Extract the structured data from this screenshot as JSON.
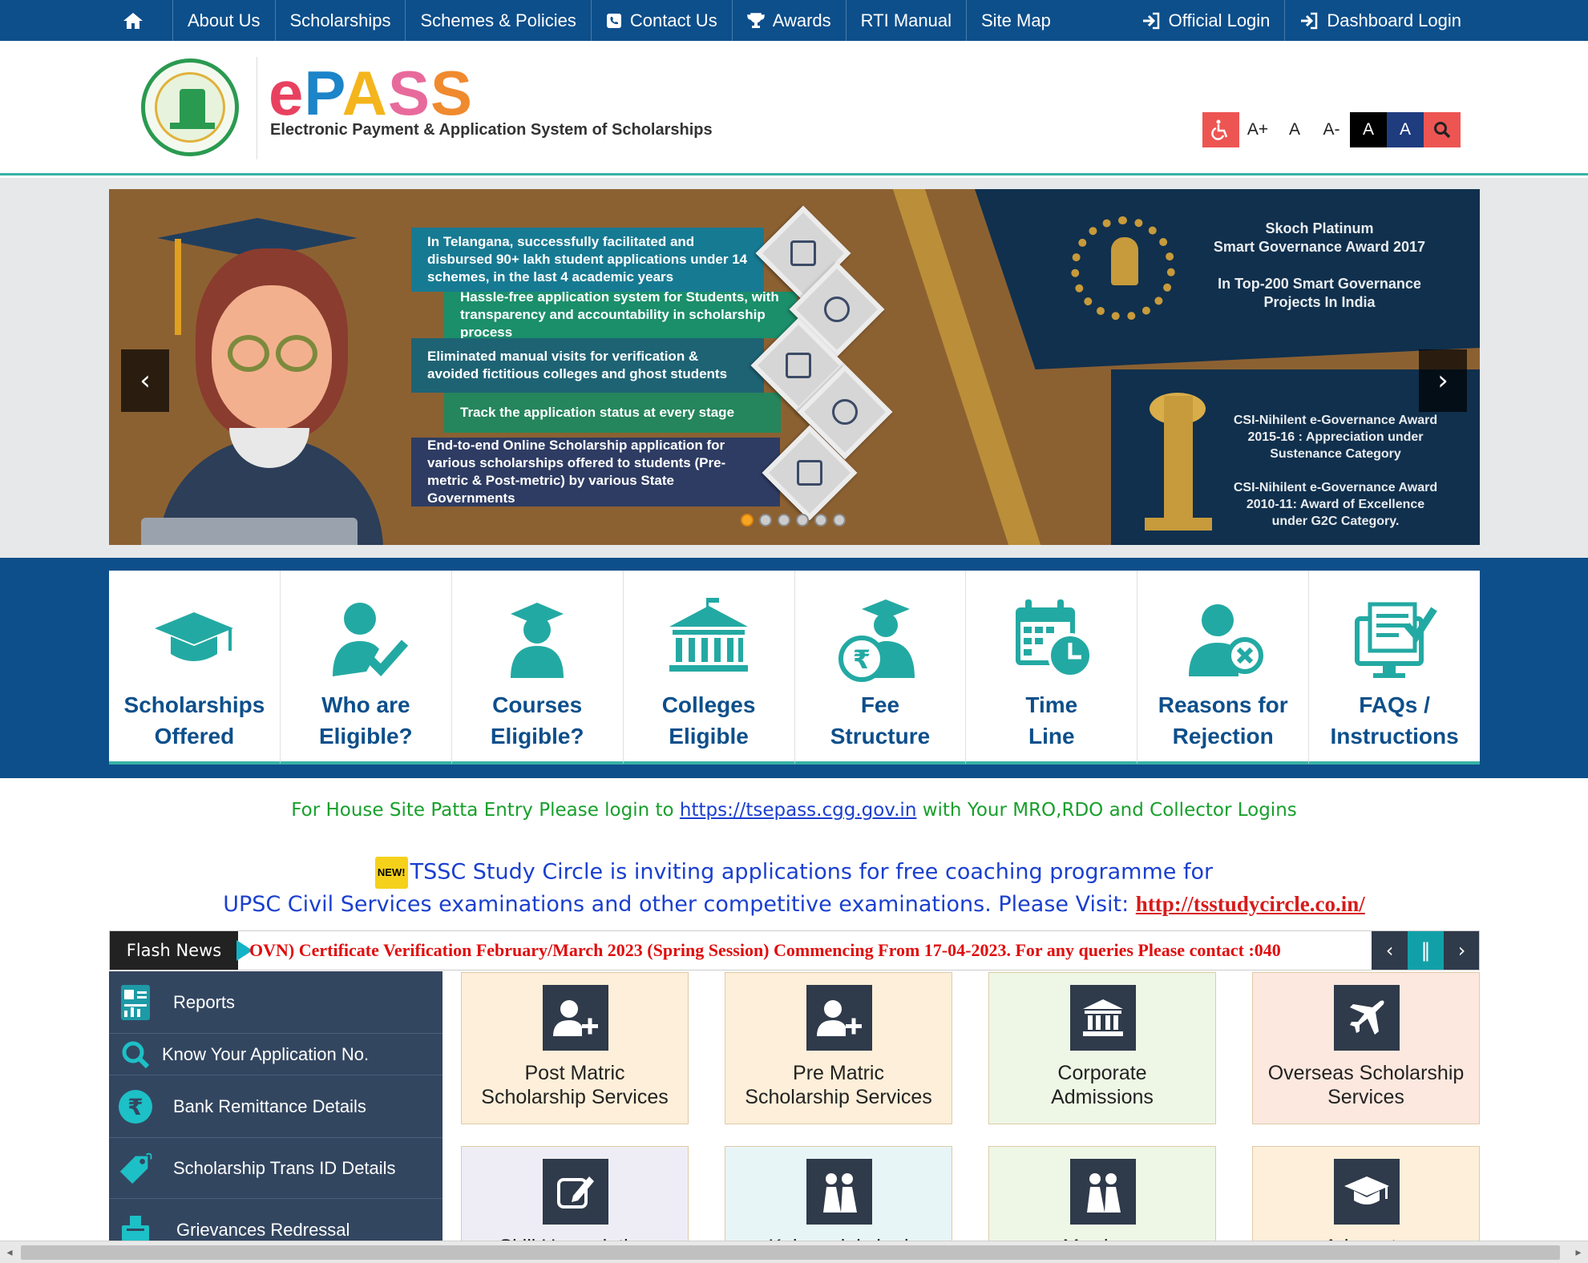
{
  "topnav": {
    "left": [
      {
        "label": "About Us"
      },
      {
        "label": "Scholarships"
      },
      {
        "label": "Schemes & Policies"
      },
      {
        "label": "Contact Us"
      },
      {
        "label": "Awards"
      },
      {
        "label": "RTI Manual"
      },
      {
        "label": "Site Map"
      }
    ],
    "right": [
      {
        "label": "Official Login"
      },
      {
        "label": "Dashboard Login"
      }
    ]
  },
  "header": {
    "logo_letters": [
      "e",
      "P",
      "A",
      "S",
      "S"
    ],
    "subtitle": "Electronic Payment & Application System of Scholarships",
    "access": {
      "a_plus": "A+",
      "a": "A",
      "a_minus": "A-",
      "a_black": "A",
      "a_navy": "A"
    }
  },
  "banner": {
    "features": [
      "In Telangana, successfully facilitated and disbursed 90+ lakh student applications under 14 schemes, in the last 4 academic years",
      "Hassle-free application system for Students, with transparency and accountability in scholarship process",
      "Eliminated manual visits for verification & avoided fictitious colleges and ghost students",
      "Track the application status at every stage",
      "End-to-end Online Scholarship application for various scholarships offered to students (Pre-metric & Post-metric) by various State Governments"
    ],
    "award1": [
      "Skoch Platinum",
      "Smart Governance Award 2017",
      "",
      "In Top-200 Smart Governance",
      "Projects In India"
    ],
    "award2": [
      "CSI-Nihilent e-Governance Award",
      "2015-16 : Appreciation under",
      "Sustenance Category",
      "",
      "CSI-Nihilent e-Governance Award",
      "2010-11: Award of Excellence",
      "under G2C Category."
    ],
    "slide_count": 6,
    "active_slide": 0
  },
  "quicklinks": [
    {
      "line1": "Scholarships",
      "line2": "Offered"
    },
    {
      "line1": "Who are",
      "line2": "Eligible?"
    },
    {
      "line1": "Courses",
      "line2": "Eligible?"
    },
    {
      "line1": "Colleges",
      "line2": "Eligible"
    },
    {
      "line1": "Fee",
      "line2": "Structure"
    },
    {
      "line1": "Time",
      "line2": "Line"
    },
    {
      "line1": "Reasons for",
      "line2": "Rejection"
    },
    {
      "line1": "FAQs /",
      "line2": "Instructions"
    }
  ],
  "notice1": {
    "prefix": "For House Site Patta Entry Please login to ",
    "link": "https://tsepass.cgg.gov.in",
    "suffix": " with Your MRO,RDO and Collector Logins"
  },
  "notice2": {
    "badge": "NEW!",
    "line1": "TSSC Study Circle is inviting applications for free coaching programme for",
    "line2": "UPSC Civil Services examinations and other competitive examinations. Please Visit: ",
    "link": "http://tsstudycircle.co.in/"
  },
  "flash": {
    "label": "Flash News",
    "text": "OVN) Certificate Verification February/March 2023 (Spring Session) Commencing From 17-04-2023. For any queries Please contact :040"
  },
  "leftmenu": [
    {
      "label": "Reports"
    },
    {
      "label": "Know Your Application No."
    },
    {
      "label": "Bank Remittance Details"
    },
    {
      "label": "Scholarship Trans ID Details"
    },
    {
      "label": "Grievances Redressal"
    }
  ],
  "tiles": [
    {
      "line1": "Post Matric",
      "line2": "Scholarship Services",
      "bg": "#fdefd9"
    },
    {
      "line1": "Pre Matric",
      "line2": "Scholarship Services",
      "bg": "#fdefd9"
    },
    {
      "line1": "Corporate",
      "line2": "Admissions",
      "bg": "#eef7e6"
    },
    {
      "line1": "Overseas Scholarship",
      "line2": "Services",
      "bg": "#fde8df"
    },
    {
      "line1": "Skill Upgradation",
      "line2": "",
      "bg": "#eeedf5"
    },
    {
      "line1": "Kalyanalakshmi",
      "line2": "",
      "bg": "#e8f5f6"
    },
    {
      "line1": "Marriage",
      "line2": "",
      "bg": "#eef7e6"
    },
    {
      "line1": "Advocate",
      "line2": "",
      "bg": "#fdefd9"
    }
  ]
}
